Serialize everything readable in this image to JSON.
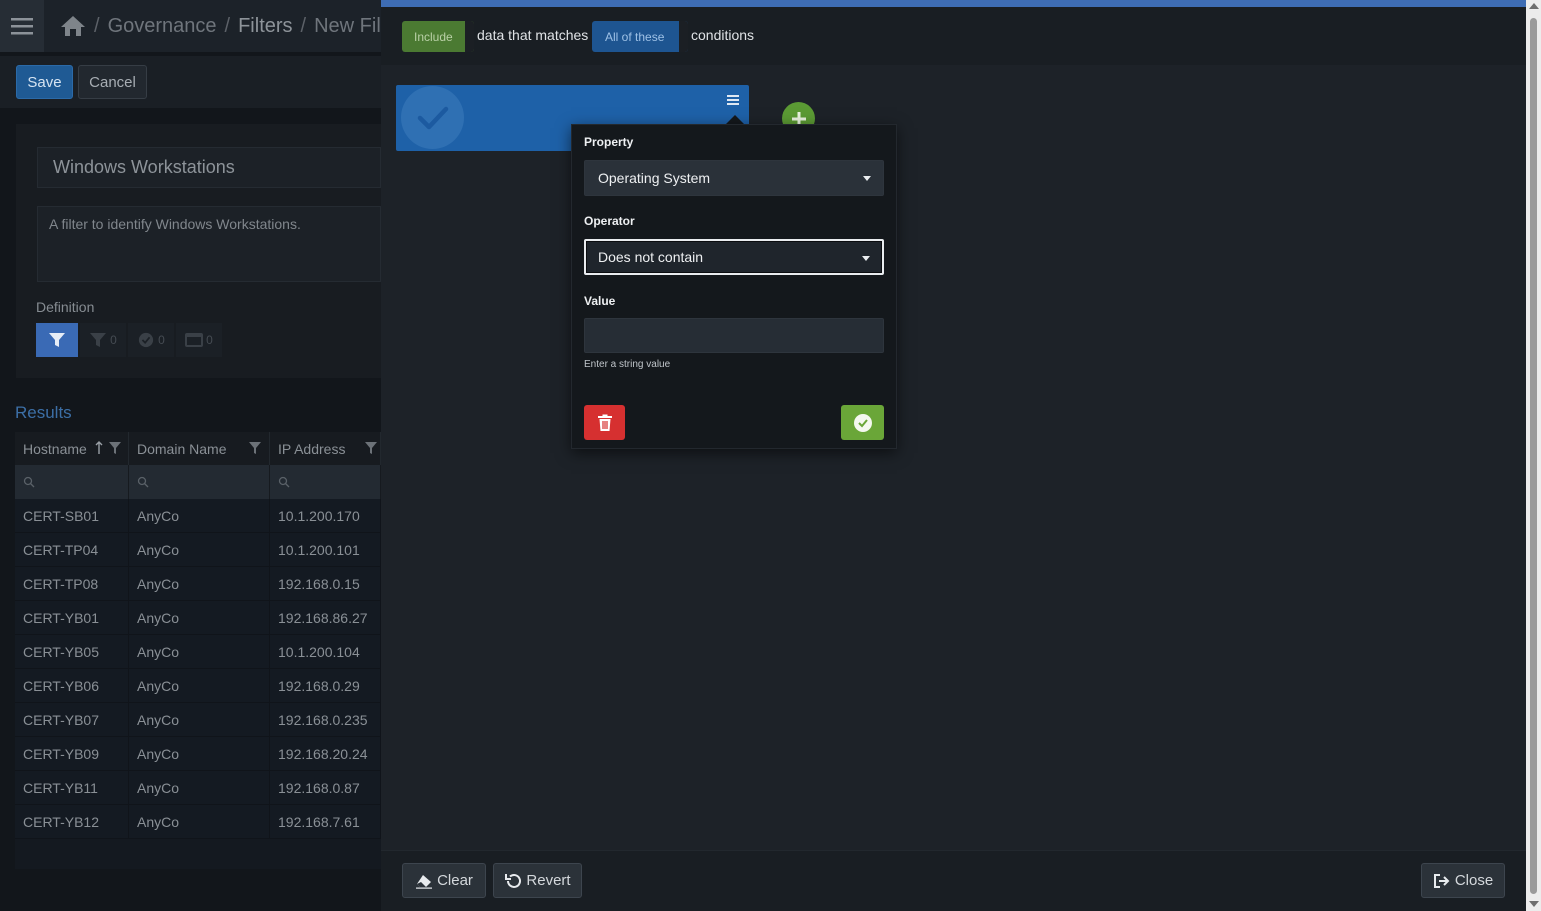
{
  "breadcrumb": {
    "items": [
      "Governance",
      "Filters",
      "New Fil"
    ],
    "separator": "/"
  },
  "toolbar": {
    "save_label": "Save",
    "cancel_label": "Cancel"
  },
  "filter": {
    "name": "Windows Workstations",
    "description": "A filter to identify Windows Workstations.",
    "definition_label": "Definition",
    "definition_tabs": [
      {
        "icon": "filter-icon",
        "count": ""
      },
      {
        "icon": "filter-outline-icon",
        "count": "0"
      },
      {
        "icon": "check-circle-icon",
        "count": "0"
      },
      {
        "icon": "window-icon",
        "count": "0"
      }
    ]
  },
  "results": {
    "title": "Results",
    "columns": [
      "Hostname",
      "Domain Name",
      "IP Address"
    ],
    "rows": [
      [
        "CERT-SB01",
        "AnyCo",
        "10.1.200.170"
      ],
      [
        "CERT-TP04",
        "AnyCo",
        "10.1.200.101"
      ],
      [
        "CERT-TP08",
        "AnyCo",
        "192.168.0.15"
      ],
      [
        "CERT-YB01",
        "AnyCo",
        "192.168.86.27"
      ],
      [
        "CERT-YB05",
        "AnyCo",
        "10.1.200.104"
      ],
      [
        "CERT-YB06",
        "AnyCo",
        "192.168.0.29"
      ],
      [
        "CERT-YB07",
        "AnyCo",
        "192.168.0.235"
      ],
      [
        "CERT-YB09",
        "AnyCo",
        "192.168.20.24"
      ],
      [
        "CERT-YB11",
        "AnyCo",
        "192.168.0.87"
      ],
      [
        "CERT-YB12",
        "AnyCo",
        "192.168.7.61"
      ]
    ]
  },
  "modal": {
    "include_label": "Include",
    "matches_text": "data that matches",
    "all_label": "All of these",
    "conditions_text": "conditions",
    "condition": {
      "property_label": "Property",
      "property_value": "Operating System",
      "operator_label": "Operator",
      "operator_value": "Does not contain",
      "value_label": "Value",
      "value": "",
      "value_hint": "Enter a string value"
    },
    "footer": {
      "clear_label": "Clear",
      "revert_label": "Revert",
      "close_label": "Close"
    }
  },
  "colors": {
    "accent": "#3e6db4",
    "include_green": "#4b7a32",
    "all_blue": "#1e5591",
    "delete_red": "#d63030",
    "confirm_green": "#6aa638"
  }
}
